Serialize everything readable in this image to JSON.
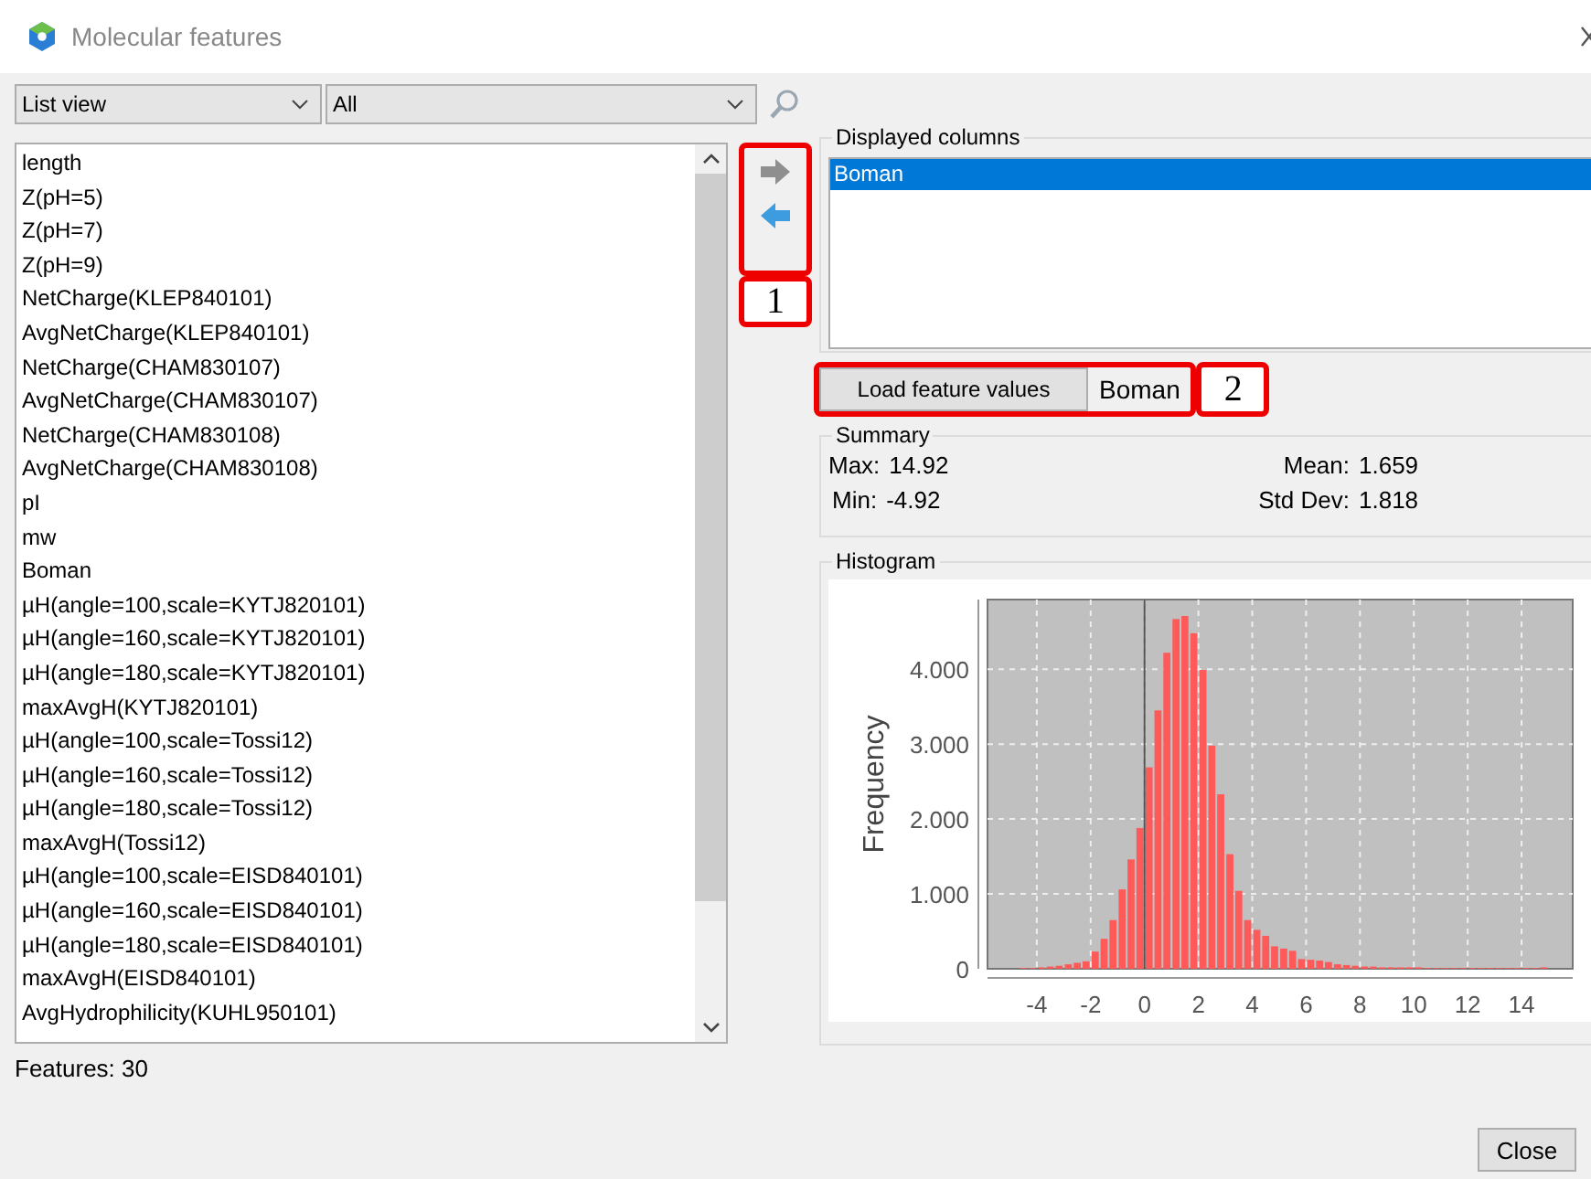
{
  "window": {
    "title": "Molecular features"
  },
  "view_select": {
    "value": "List view"
  },
  "filter_select": {
    "value": "All"
  },
  "features": [
    {
      "label": "length",
      "selected": false
    },
    {
      "label": "Z(pH=5)",
      "selected": false
    },
    {
      "label": "Z(pH=7)",
      "selected": false
    },
    {
      "label": "Z(pH=9)",
      "selected": false
    },
    {
      "label": "NetCharge(KLEP840101)",
      "selected": false
    },
    {
      "label": "AvgNetCharge(KLEP840101)",
      "selected": false
    },
    {
      "label": "NetCharge(CHAM830107)",
      "selected": false
    },
    {
      "label": "AvgNetCharge(CHAM830107)",
      "selected": false
    },
    {
      "label": "NetCharge(CHAM830108)",
      "selected": false
    },
    {
      "label": "AvgNetCharge(CHAM830108)",
      "selected": false
    },
    {
      "label": "pI",
      "selected": false
    },
    {
      "label": "mw",
      "selected": false
    },
    {
      "label": "Boman",
      "selected": false
    },
    {
      "label": "µH(angle=100,scale=KYTJ820101)",
      "selected": false
    },
    {
      "label": "µH(angle=160,scale=KYTJ820101)",
      "selected": false
    },
    {
      "label": "µH(angle=180,scale=KYTJ820101)",
      "selected": false
    },
    {
      "label": "maxAvgH(KYTJ820101)",
      "selected": false
    },
    {
      "label": "µH(angle=100,scale=Tossi12)",
      "selected": false
    },
    {
      "label": "µH(angle=160,scale=Tossi12)",
      "selected": false
    },
    {
      "label": "µH(angle=180,scale=Tossi12)",
      "selected": false
    },
    {
      "label": "maxAvgH(Tossi12)",
      "selected": false
    },
    {
      "label": "µH(angle=100,scale=EISD840101)",
      "selected": false
    },
    {
      "label": "µH(angle=160,scale=EISD840101)",
      "selected": false
    },
    {
      "label": "µH(angle=180,scale=EISD840101)",
      "selected": false
    },
    {
      "label": "maxAvgH(EISD840101)",
      "selected": false
    },
    {
      "label": "AvgHydrophilicity(KUHL950101)",
      "selected": false
    }
  ],
  "feature_count": "Features: 30",
  "displayed_columns": {
    "title": "Displayed columns",
    "items": [
      {
        "label": "Boman",
        "selected": true
      }
    ]
  },
  "load_button": "Load feature values",
  "loaded_feature": "Boman",
  "summary": {
    "title": "Summary",
    "stats": [
      {
        "label": "Max:",
        "value": "14.92"
      },
      {
        "label": "Mean:",
        "value": "1.659"
      },
      {
        "label": "Min:",
        "value": "-4.92"
      },
      {
        "label": "Std Dev:",
        "value": "1.818"
      }
    ]
  },
  "histogram": {
    "title": "Histogram",
    "chart_data": {
      "type": "bar",
      "ylabel": "Frequency",
      "x": [
        -4.5,
        -4.17,
        -3.83,
        -3.5,
        -3.17,
        -2.83,
        -2.5,
        -2.17,
        -1.83,
        -1.5,
        -1.17,
        -0.83,
        -0.5,
        -0.17,
        0.17,
        0.5,
        0.83,
        1.17,
        1.5,
        1.83,
        2.17,
        2.5,
        2.83,
        3.17,
        3.5,
        3.83,
        4.17,
        4.5,
        4.83,
        5.17,
        5.5,
        5.83,
        6.17,
        6.5,
        6.83,
        7.17,
        7.5,
        7.83,
        8.17,
        8.5,
        8.83,
        9.17,
        9.5,
        9.83,
        10.17,
        10.5,
        10.83,
        11.17,
        11.5,
        11.83,
        12.17,
        12.5,
        12.83,
        13.17,
        13.5,
        13.83,
        14.17,
        14.5,
        14.83
      ],
      "values": [
        0.01,
        0.01,
        0.02,
        0.03,
        0.04,
        0.06,
        0.08,
        0.1,
        0.23,
        0.4,
        0.65,
        1.06,
        1.46,
        1.88,
        2.69,
        3.45,
        4.22,
        4.67,
        4.71,
        4.48,
        3.99,
        2.98,
        2.33,
        1.53,
        1.04,
        0.65,
        0.52,
        0.44,
        0.3,
        0.27,
        0.24,
        0.13,
        0.12,
        0.11,
        0.09,
        0.06,
        0.05,
        0.04,
        0.03,
        0.03,
        0.02,
        0.02,
        0.02,
        0.02,
        0.02,
        0.01,
        0.01,
        0.01,
        0.01,
        0.01,
        0.01,
        0.01,
        0.01,
        0.01,
        0.01,
        0.01,
        0.01,
        0.01,
        0.02
      ],
      "xlim": [
        -5.83,
        15.9
      ],
      "ylim": [
        0,
        4.93
      ],
      "grid": true,
      "xticks": [
        -4,
        -2,
        0,
        2,
        4,
        6,
        8,
        10,
        12,
        14
      ],
      "yticks": [
        {
          "value": 0,
          "label": "0"
        },
        {
          "value": 1,
          "label": "1.000"
        },
        {
          "value": 2,
          "label": "2.000"
        },
        {
          "value": 3,
          "label": "3.000"
        },
        {
          "value": 4,
          "label": "4.000"
        }
      ]
    }
  },
  "callouts": [
    {
      "label": "1"
    },
    {
      "label": "2"
    }
  ],
  "close_button": "Close"
}
